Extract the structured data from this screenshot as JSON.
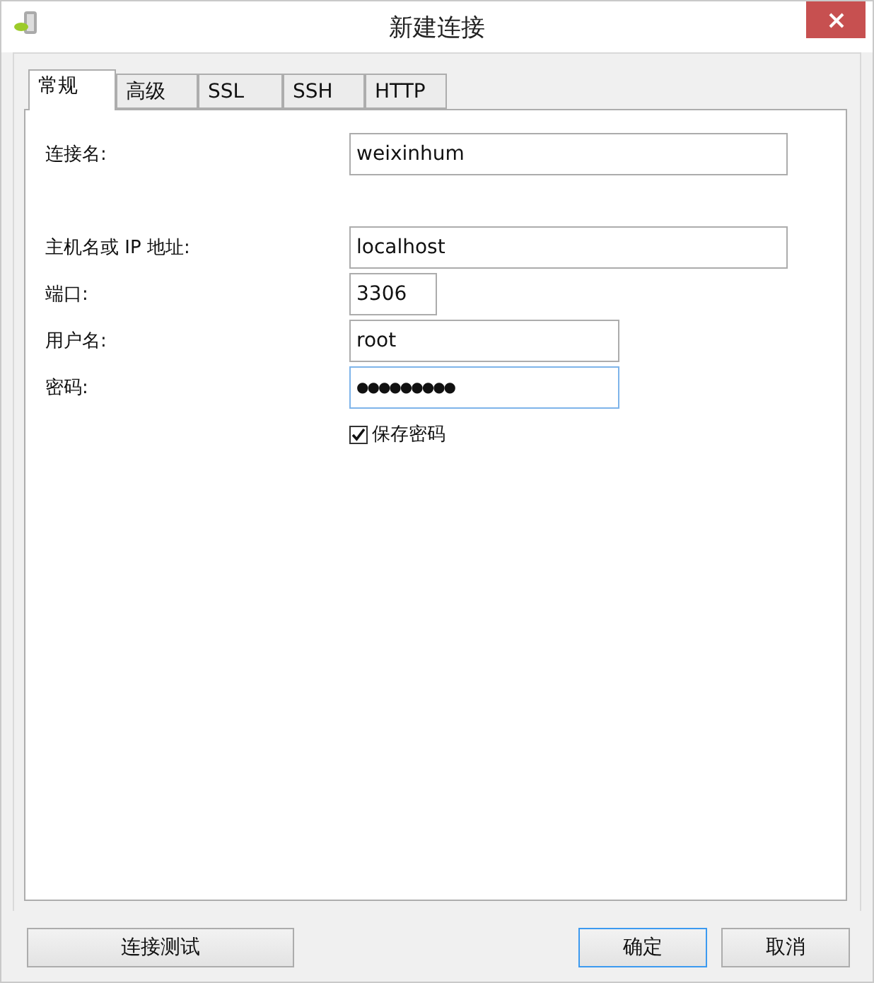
{
  "window": {
    "title": "新建连接"
  },
  "tabs": [
    {
      "label": "常规",
      "selected": true
    },
    {
      "label": "高级",
      "selected": false
    },
    {
      "label": "SSL",
      "selected": false
    },
    {
      "label": "SSH",
      "selected": false
    },
    {
      "label": "HTTP",
      "selected": false
    }
  ],
  "fields": [
    {
      "label": "连接名:",
      "value": "weixinhum",
      "kind": "text",
      "focused": false
    },
    {
      "label": "主机名或 IP 地址:",
      "value": "localhost",
      "kind": "text",
      "focused": false
    },
    {
      "label": "端口:",
      "value": "3306",
      "kind": "text",
      "focused": false
    },
    {
      "label": "用户名:",
      "value": "root",
      "kind": "text",
      "focused": false
    },
    {
      "label": "密码:",
      "value": "●●●●●●●●●",
      "kind": "password",
      "focused": true
    }
  ],
  "save_password": {
    "label": "保存密码",
    "checked": true
  },
  "buttons": [
    {
      "label": "连接测试",
      "focused": false
    },
    {
      "label": "确定",
      "focused": true
    },
    {
      "label": "取消",
      "focused": false
    }
  ]
}
